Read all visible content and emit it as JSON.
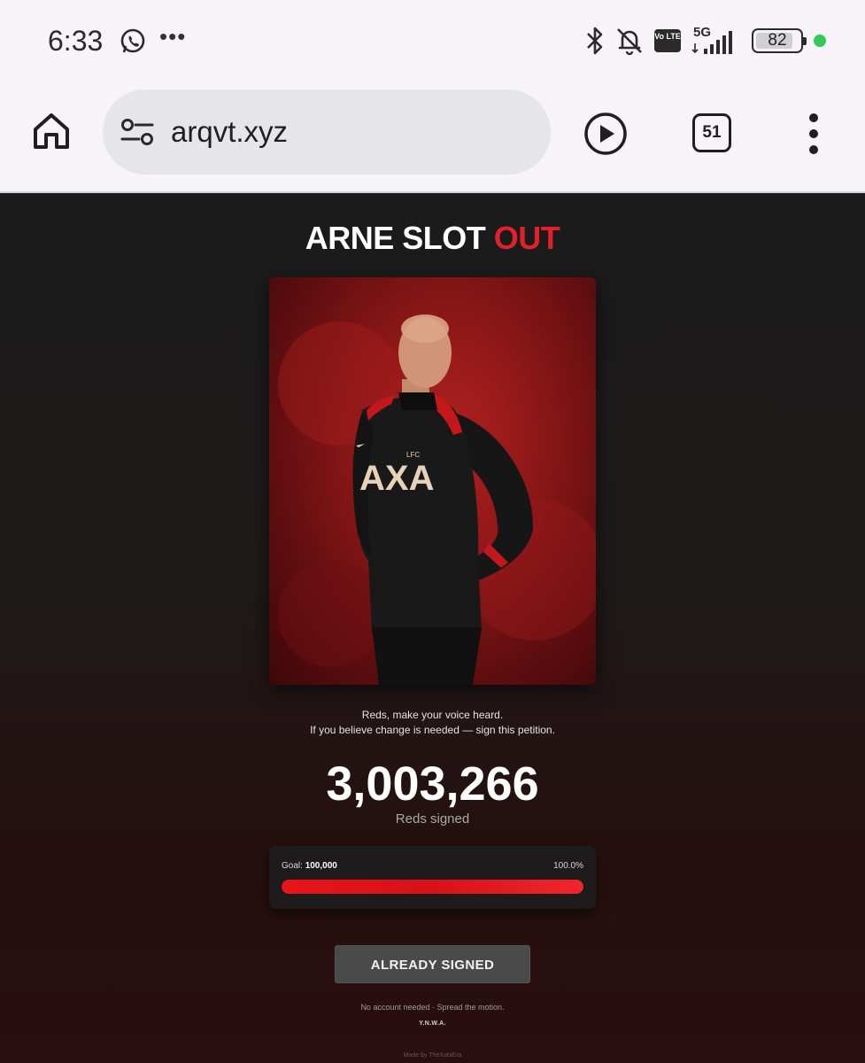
{
  "status_bar": {
    "time": "6:33",
    "network": "5G",
    "volte": "Vo LTE",
    "battery": "82"
  },
  "browser": {
    "url": "arqvt.xyz",
    "tab_count": "51"
  },
  "page": {
    "title_part1": "ARNE SLOT",
    "title_part2": "OUT",
    "title_accent_color": "#e0202a",
    "tagline_line1": "Reds, make your voice heard.",
    "tagline_line2": "If you believe change is needed — sign this petition.",
    "signature_count": "3,003,266",
    "signature_label": "Reds signed",
    "goal_label": "Goal:",
    "goal_value": "100,000",
    "goal_percent": "100.0%",
    "goal_progress_fraction": 1.0,
    "button_label": "ALREADY SIGNED",
    "footer_note": "No account needed · Spread the motion.",
    "footer_motto": "Y.N.W.A.",
    "credit": "Made by TheXabiEra"
  },
  "photo": {
    "shirt_sponsor": "AXA",
    "crest_text": "LFC"
  }
}
